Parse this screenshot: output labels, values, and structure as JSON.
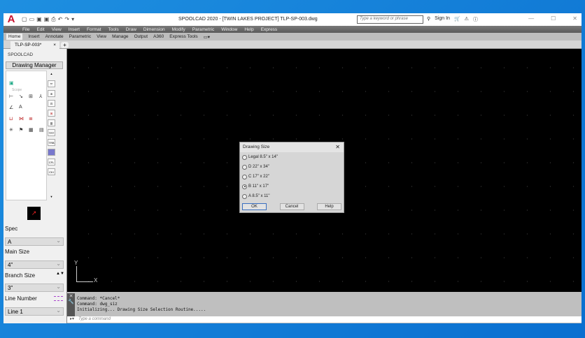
{
  "titlebar": {
    "logo": "A",
    "title": "SPOOLCAD 2020 - [TWIN LAKES PROJECT]   TLP-SP-003.dwg",
    "search_placeholder": "Type a keyword or phrase",
    "sign_in": "Sign In"
  },
  "menu": [
    "File",
    "Edit",
    "View",
    "Insert",
    "Format",
    "Tools",
    "Draw",
    "Dimension",
    "Modify",
    "Parametric",
    "Window",
    "Help",
    "Express"
  ],
  "ribbon_tabs": [
    "Home",
    "Insert",
    "Annotate",
    "Parametric",
    "View",
    "Manage",
    "Output",
    "A360",
    "Express Tools"
  ],
  "doc_tab": "TLP-SP-003*",
  "panel": {
    "title": "SPOOLCAD",
    "drawing_manager": "Drawing Manager",
    "tooltip": "Scope",
    "side_buttons": [
      "TRT",
      "TRB",
      "CFL",
      "CKI"
    ],
    "spec_label": "Spec",
    "spec_value": "A",
    "main_size_label": "Main Size",
    "main_size_value": "4\"",
    "branch_size_label": "Branch Size",
    "branch_size_value": "3\"",
    "line_number_label": "Line Number",
    "line_number_value": "Line 1"
  },
  "ucs": {
    "x": "X",
    "y": "Y"
  },
  "dialog": {
    "title": "Drawing Size",
    "options": [
      {
        "label": "Legal  8.5\" x 14\"",
        "selected": false
      },
      {
        "label": "D    22\" x 34\"",
        "selected": false
      },
      {
        "label": "C    17\" x 22\"",
        "selected": false
      },
      {
        "label": "B    11\" x 17\"",
        "selected": true
      },
      {
        "label": "A    8.5\" x 11\"",
        "selected": false
      }
    ],
    "ok": "OK",
    "cancel": "Cancel",
    "help": "Help"
  },
  "command": {
    "history": [
      "Command: *Cancel*",
      "Command: dwg_siz",
      "Initializing... Drawing Size Selection Routine....."
    ],
    "placeholder": "Type a command"
  }
}
